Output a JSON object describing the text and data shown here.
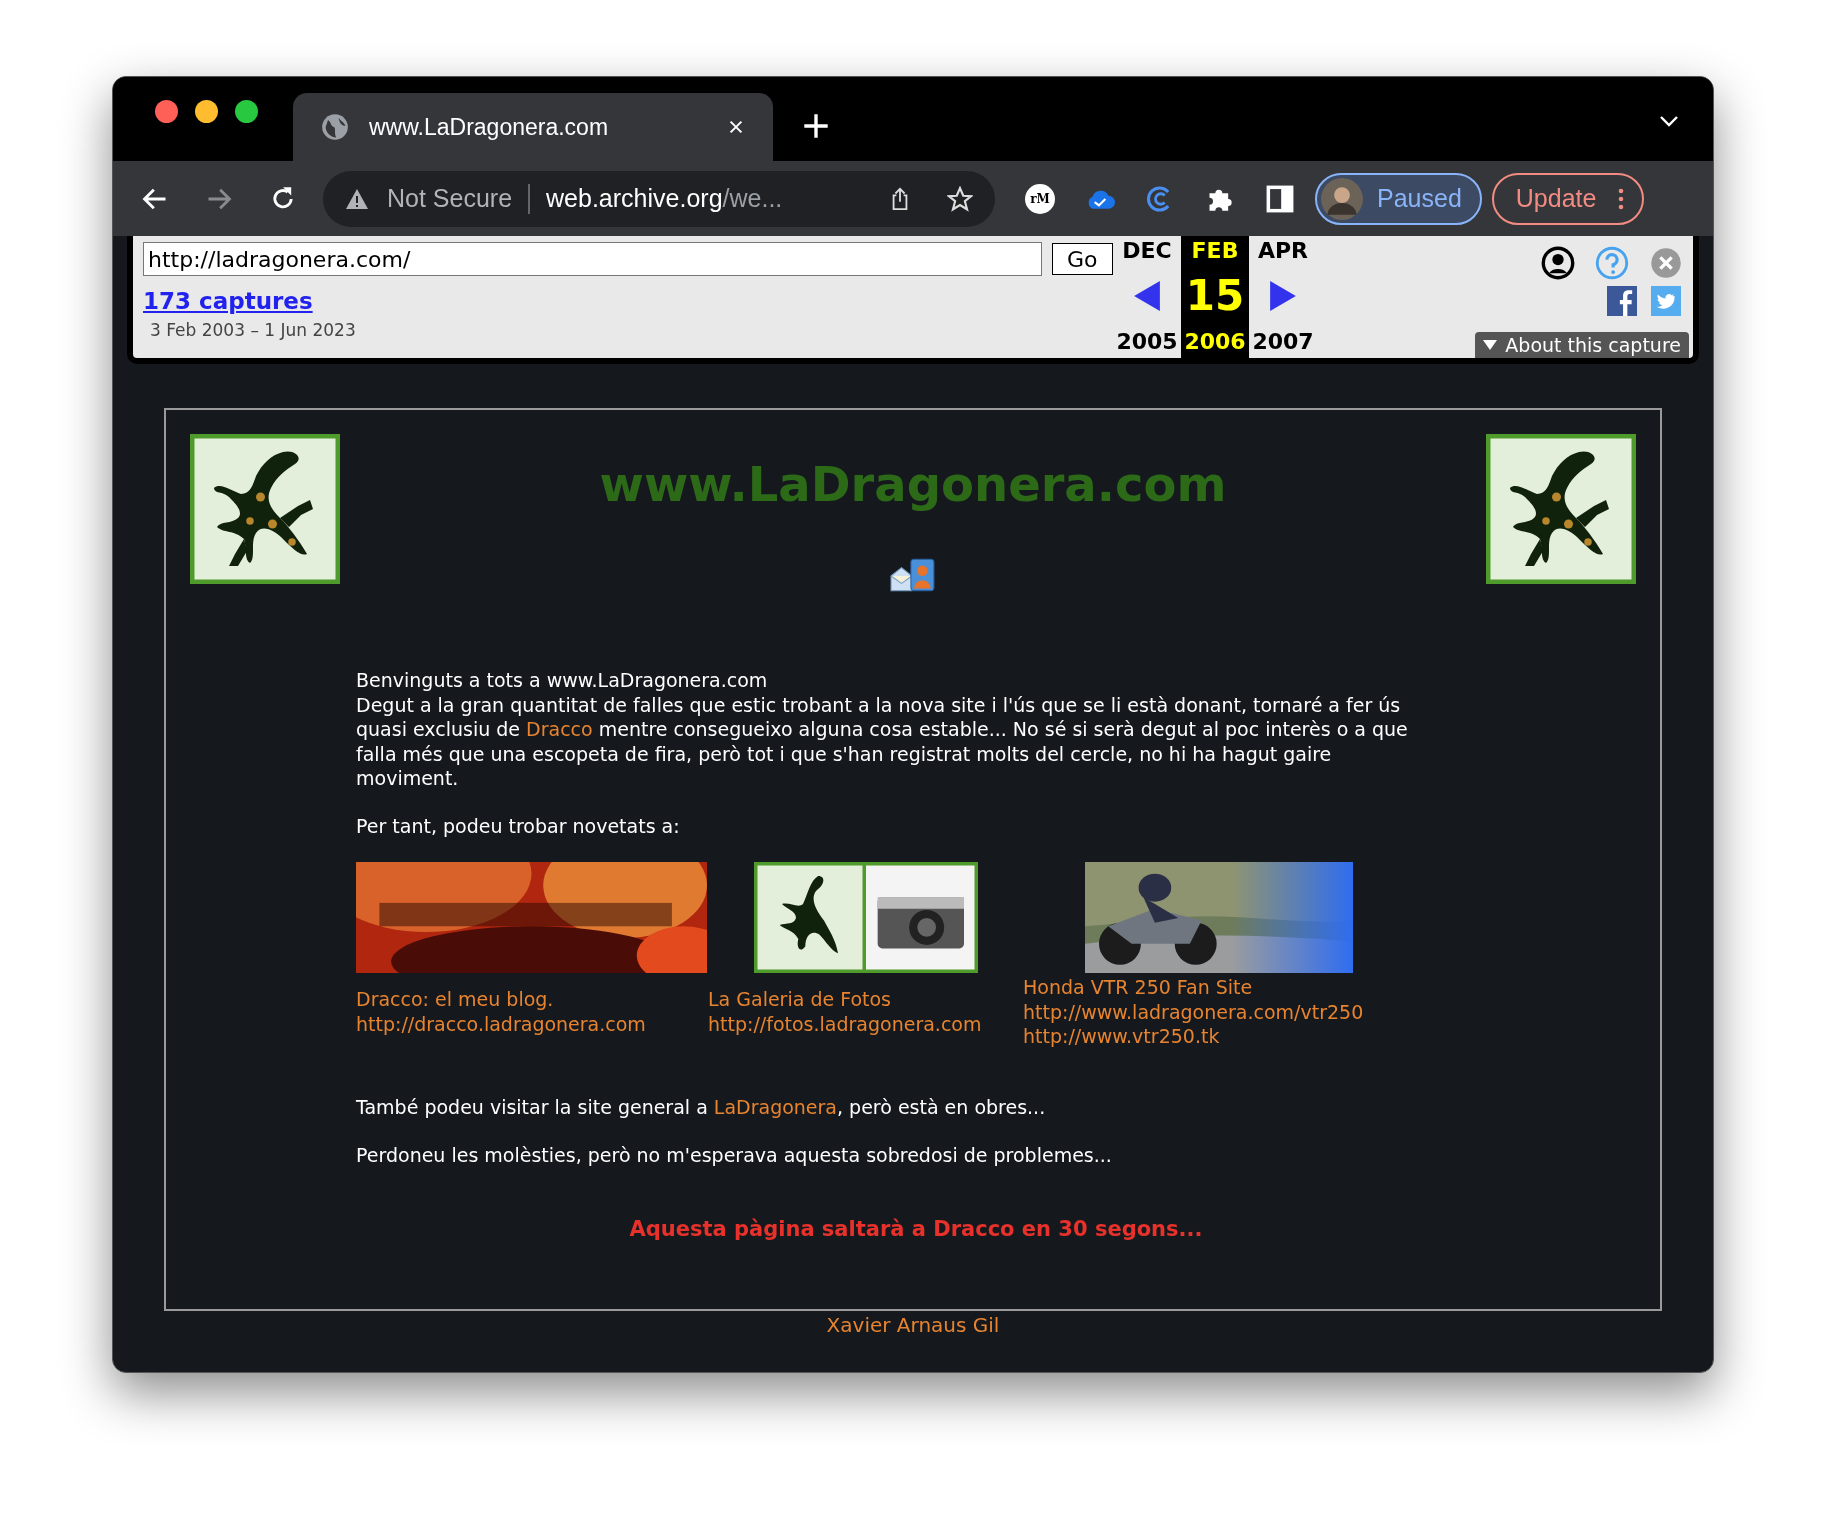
{
  "browser": {
    "tab_title": "www.LaDragonera.com",
    "security": "Not Secure",
    "url_host": "web.archive.org",
    "url_rest": "/we...",
    "extensions": [
      {
        "kind": "badge",
        "label": "rM"
      },
      {
        "kind": "cloud"
      },
      {
        "kind": "ring"
      },
      {
        "kind": "puzzle"
      },
      {
        "kind": "sidebar"
      }
    ],
    "profile_status": "Paused",
    "update_label": "Update"
  },
  "wayback": {
    "url": "http://ladragonera.com/",
    "go": "Go",
    "captures": "173 captures",
    "range": "3 Feb 2003 – 1 Jun 2023",
    "prev": {
      "month": "DEC",
      "year": "2005"
    },
    "current": {
      "month": "FEB",
      "day": "15",
      "year": "2006"
    },
    "next": {
      "month": "APR",
      "year": "2007"
    },
    "about": "About this capture"
  },
  "page": {
    "title": "www.LaDragonera.com",
    "welcome": "Benvinguts a tots a www.LaDragonera.com",
    "paragraphs": [
      {
        "parts": [
          {
            "kind": "plain",
            "text": "Degut a la gran quantitat de falles que estic trobant a la nova site i l'ús que se li està donant, tornaré a fer ús quasi exclusiu de "
          },
          {
            "kind": "link",
            "text": "Dracco"
          },
          {
            "kind": "plain",
            "text": " mentre consegueixo alguna cosa estable... No sé si serà degut al poc interès o a que falla més que una escopeta de fira, però tot i que s'han registrat molts del cercle, no hi ha hagut gaire moviment."
          }
        ]
      },
      {
        "parts": [
          {
            "kind": "plain",
            "text": "Per tant, podeu trobar novetats a:"
          }
        ]
      }
    ],
    "links": [
      {
        "kind": "banner",
        "lines": [
          "Dracco: el meu blog.",
          "http://dracco.ladragonera.com"
        ]
      },
      {
        "kind": "gallery",
        "lines": [
          "La Galeria de Fotos",
          "http://fotos.ladragonera.com"
        ]
      },
      {
        "lines": [
          "Honda VTR 250 Fan Site",
          "http://www.ladragonera.com/vtr250",
          "http://www.vtr250.tk"
        ]
      }
    ],
    "after": [
      {
        "parts": [
          {
            "kind": "plain",
            "text": "També podeu visitar la site general a "
          },
          {
            "kind": "link",
            "text": "LaDragonera"
          },
          {
            "kind": "plain",
            "text": ", però està en obres..."
          }
        ]
      },
      {
        "parts": [
          {
            "kind": "plain",
            "text": "Perdoneu les molèsties, però no m'esperava aquesta sobredosi de problemes..."
          }
        ]
      }
    ],
    "redirect_notice": "Aquesta pàgina saltarà a Dracco en 30 segons...",
    "footer": "Xavier Arnaus Gil"
  }
}
